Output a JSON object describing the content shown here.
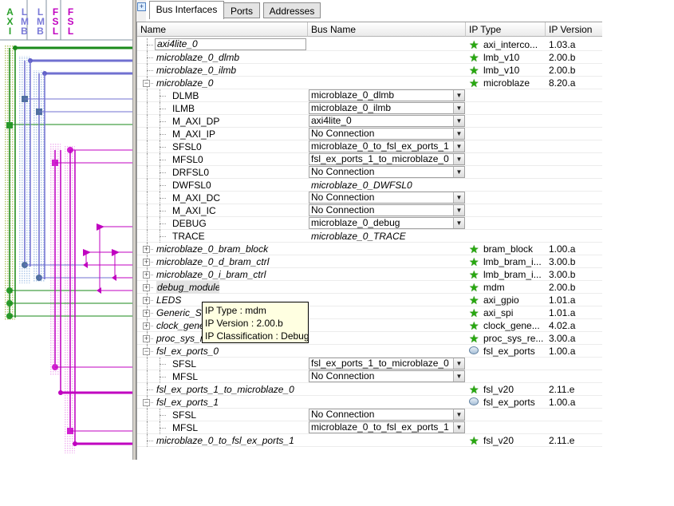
{
  "bus_panel": {
    "headers": [
      [
        "A",
        "X",
        "I"
      ],
      [
        "L",
        "M",
        "B"
      ],
      [
        "L",
        "M",
        "B"
      ],
      [
        "F",
        "S",
        "L"
      ],
      [
        "F",
        "S",
        "L"
      ]
    ],
    "header_colors": [
      "#2aa02a",
      "#7a7ad8",
      "#7a7ad8",
      "#c000c0",
      "#c000c0"
    ]
  },
  "tabs": [
    {
      "label": "Bus Interfaces",
      "active": true
    },
    {
      "label": "Ports",
      "active": false
    },
    {
      "label": "Addresses",
      "active": false
    }
  ],
  "columns": {
    "name": "Name",
    "bus_name": "Bus Name",
    "ip_type": "IP Type",
    "ip_version": "IP Version"
  },
  "rows": [
    {
      "level": 0,
      "expander": "",
      "name": "axi4lite_0",
      "edit": true,
      "bus": "",
      "ip_type": "axi_interco...",
      "version": "1.03.a",
      "icon": "star"
    },
    {
      "level": 0,
      "expander": "",
      "name": "microblaze_0_dlmb",
      "bus": "",
      "ip_type": "lmb_v10",
      "version": "2.00.b",
      "icon": "star"
    },
    {
      "level": 0,
      "expander": "",
      "name": "microblaze_0_ilmb",
      "bus": "",
      "ip_type": "lmb_v10",
      "version": "2.00.b",
      "icon": "star"
    },
    {
      "level": 0,
      "expander": "minus",
      "name": "microblaze_0",
      "bus": "",
      "ip_type": "microblaze",
      "version": "8.20.a",
      "icon": "star"
    },
    {
      "level": 1,
      "name": "DLMB",
      "combo": true,
      "bus": "microblaze_0_dlmb"
    },
    {
      "level": 1,
      "name": "ILMB",
      "combo": true,
      "bus": "microblaze_0_ilmb"
    },
    {
      "level": 1,
      "name": "M_AXI_DP",
      "combo": true,
      "bus": "axi4lite_0"
    },
    {
      "level": 1,
      "name": "M_AXI_IP",
      "combo": true,
      "bus": "No Connection"
    },
    {
      "level": 1,
      "name": "SFSL0",
      "combo": true,
      "bus": "microblaze_0_to_fsl_ex_ports_1"
    },
    {
      "level": 1,
      "name": "MFSL0",
      "combo": true,
      "bus": "fsl_ex_ports_1_to_microblaze_0"
    },
    {
      "level": 1,
      "name": "DRFSL0",
      "combo": true,
      "bus": "No Connection"
    },
    {
      "level": 1,
      "name": "DWFSL0",
      "combo": false,
      "bus": "microblaze_0_DWFSL0"
    },
    {
      "level": 1,
      "name": "M_AXI_DC",
      "combo": true,
      "bus": "No Connection"
    },
    {
      "level": 1,
      "name": "M_AXI_IC",
      "combo": true,
      "bus": "No Connection"
    },
    {
      "level": 1,
      "name": "DEBUG",
      "combo": true,
      "bus": "microblaze_0_debug"
    },
    {
      "level": 1,
      "name": "TRACE",
      "combo": false,
      "bus": "microblaze_0_TRACE"
    },
    {
      "level": 0,
      "expander": "plus",
      "name": "microblaze_0_bram_block",
      "bus": "",
      "ip_type": "bram_block",
      "version": "1.00.a",
      "icon": "star"
    },
    {
      "level": 0,
      "expander": "plus",
      "name": "microblaze_0_d_bram_ctrl",
      "bus": "",
      "ip_type": "lmb_bram_i...",
      "version": "3.00.b",
      "icon": "star"
    },
    {
      "level": 0,
      "expander": "plus",
      "name": "microblaze_0_i_bram_ctrl",
      "bus": "",
      "ip_type": "lmb_bram_i...",
      "version": "3.00.b",
      "icon": "star"
    },
    {
      "level": 0,
      "expander": "plus",
      "name": "debug_module",
      "highlight": true,
      "bus": "",
      "ip_type": "mdm",
      "version": "2.00.b",
      "icon": "star"
    },
    {
      "level": 0,
      "expander": "plus",
      "name": "LEDS",
      "bus": "",
      "ip_type": "axi_gpio",
      "version": "1.01.a",
      "icon": "star"
    },
    {
      "level": 0,
      "expander": "plus",
      "name": "Generic_SP",
      "bus": "",
      "ip_type": "axi_spi",
      "version": "1.01.a",
      "icon": "star"
    },
    {
      "level": 0,
      "expander": "plus",
      "name": "clock_gene",
      "bus": "",
      "ip_type": "clock_gene...",
      "version": "4.02.a",
      "icon": "star"
    },
    {
      "level": 0,
      "expander": "plus",
      "name": "proc_sys_re",
      "bus": "",
      "ip_type": "proc_sys_re...",
      "version": "3.00.a",
      "icon": "star"
    },
    {
      "level": 0,
      "expander": "minus",
      "name": "fsl_ex_ports_0",
      "bus": "",
      "ip_type": "fsl_ex_ports",
      "version": "1.00.a",
      "icon": "ext"
    },
    {
      "level": 1,
      "name": "SFSL",
      "combo": true,
      "bus": "fsl_ex_ports_1_to_microblaze_0"
    },
    {
      "level": 1,
      "name": "MFSL",
      "combo": true,
      "bus": "No Connection"
    },
    {
      "level": 0,
      "expander": "",
      "name": "fsl_ex_ports_1_to_microblaze_0",
      "bus": "",
      "ip_type": "fsl_v20",
      "version": "2.11.e",
      "icon": "star"
    },
    {
      "level": 0,
      "expander": "minus",
      "name": "fsl_ex_ports_1",
      "bus": "",
      "ip_type": "fsl_ex_ports",
      "version": "1.00.a",
      "icon": "ext"
    },
    {
      "level": 1,
      "name": "SFSL",
      "combo": true,
      "bus": "No Connection"
    },
    {
      "level": 1,
      "name": "MFSL",
      "combo": true,
      "bus": "microblaze_0_to_fsl_ex_ports_1"
    },
    {
      "level": 0,
      "expander": "",
      "name": "microblaze_0_to_fsl_ex_ports_1",
      "bus": "",
      "ip_type": "fsl_v20",
      "version": "2.11.e",
      "icon": "star"
    }
  ],
  "tooltip": {
    "line1": "IP Type : mdm",
    "line2": "IP Version : 2.00.b",
    "line3": "IP Classification : Debug"
  },
  "colors": {
    "axi": "#2a8a2a",
    "lmb": "#7070d0",
    "fsl": "#c000c0",
    "star": "#27a80f"
  }
}
